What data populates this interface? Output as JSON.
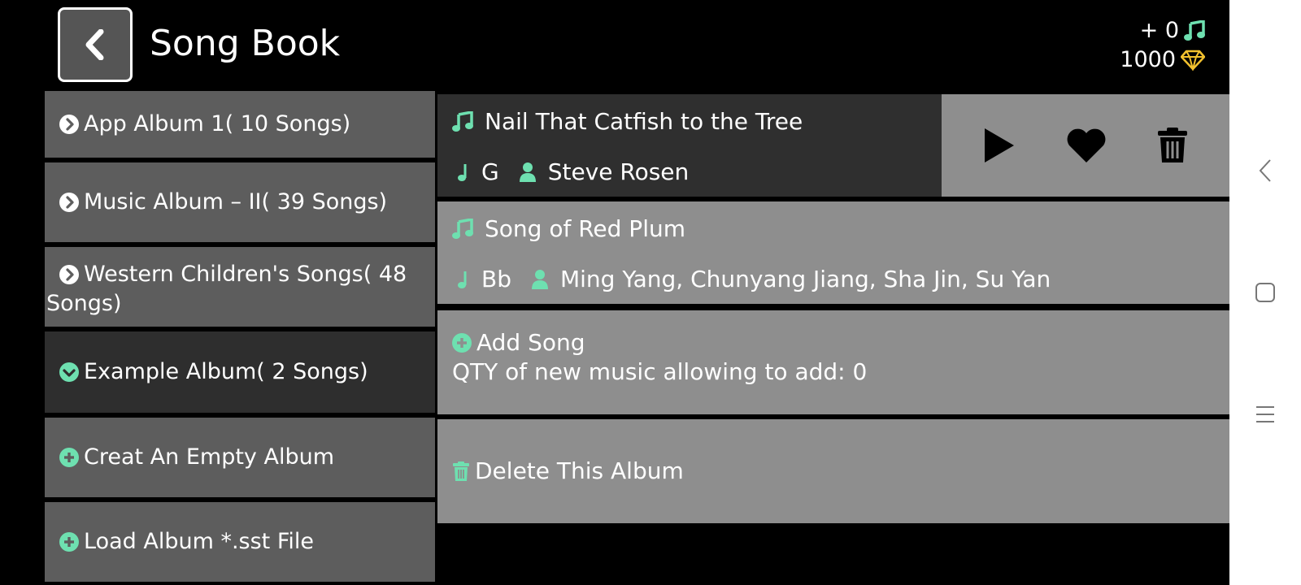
{
  "header": {
    "title": "Song Book",
    "back_icon": "chevron-left-icon"
  },
  "stats": {
    "notes": "+ 0",
    "notes_icon": "music-note-icon",
    "gems": "1000",
    "gems_icon": "diamond-icon"
  },
  "albums": [
    {
      "label": "App Album 1( 10 Songs)",
      "icon": "chevron-circle-right-icon"
    },
    {
      "label": "Music Album – II( 39 Songs)",
      "icon": "chevron-circle-right-icon"
    },
    {
      "label": "Western Children's Songs( 48 Songs)",
      "icon": "chevron-circle-right-icon"
    },
    {
      "label": "Example Album( 2 Songs)",
      "icon": "chevron-circle-down-icon",
      "active": true
    },
    {
      "label": "Creat An Empty Album",
      "icon": "plus-circle-icon"
    },
    {
      "label": "Load Album *.sst File",
      "icon": "plus-circle-icon"
    }
  ],
  "songs": [
    {
      "title": "Nail That Catfish to the Tree",
      "key": "G",
      "artist": "Steve Rosen",
      "selected": true
    },
    {
      "title": "Song of Red Plum",
      "key": "Bb",
      "artist": "Ming Yang, Chunyang Jiang, Sha Jin, Su Yan"
    }
  ],
  "song_actions": {
    "play_icon": "play-icon",
    "favorite_icon": "heart-icon",
    "delete_icon": "trash-icon"
  },
  "add_song": {
    "label": "Add Song",
    "quota_text": "QTY of new music allowing to add: 0"
  },
  "delete_album": {
    "label": "Delete This Album"
  },
  "colors": {
    "accent": "#6ee0b0",
    "gold": "#f2c12e",
    "panel": "#8e8e8e",
    "album": "#5d5d5d",
    "selected": "#2f2f2f"
  }
}
